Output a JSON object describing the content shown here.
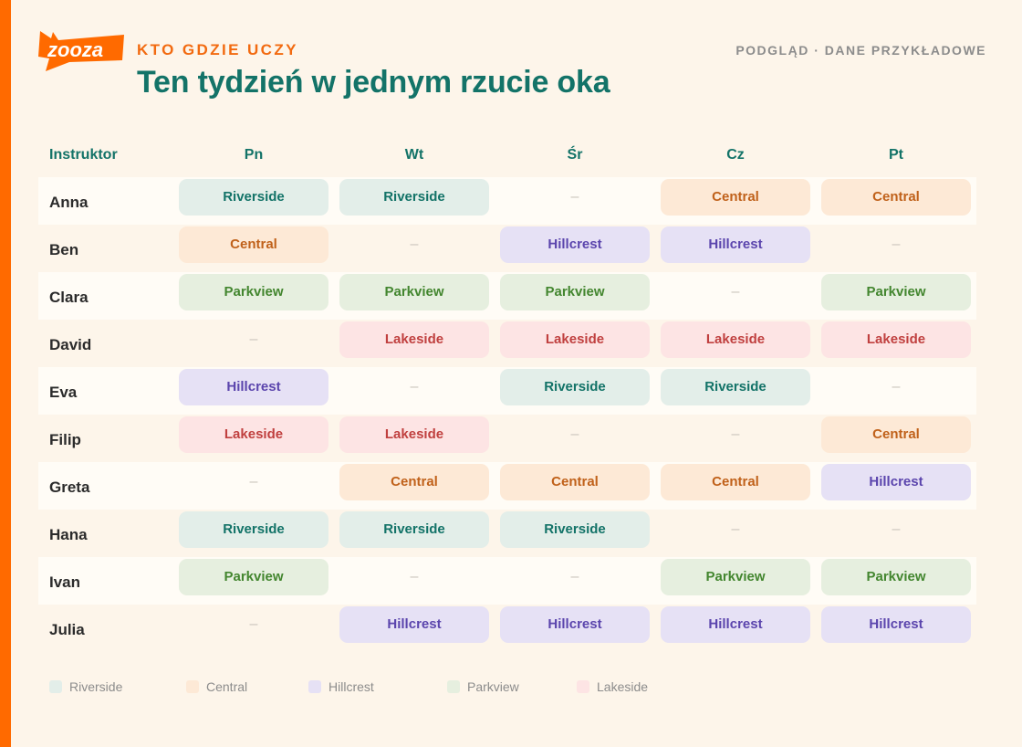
{
  "brand": {
    "logo_text": "zooza",
    "accent": "#ff6a00"
  },
  "header": {
    "kicker": "KTO GDZIE UCZY",
    "title": "Ten tydzień w jednym rzucie oka",
    "preview": "PODGLĄD · DANE PRZYKŁADOWE"
  },
  "table": {
    "name_header": "Instruktor",
    "days": [
      "Pn",
      "Wt",
      "Śr",
      "Cz",
      "Pt"
    ],
    "empty_symbol": "–",
    "rows": [
      {
        "name": "Anna",
        "cells": [
          "Riverside",
          "Riverside",
          "",
          "Central",
          "Central"
        ]
      },
      {
        "name": "Ben",
        "cells": [
          "Central",
          "",
          "Hillcrest",
          "Hillcrest",
          ""
        ]
      },
      {
        "name": "Clara",
        "cells": [
          "Parkview",
          "Parkview",
          "Parkview",
          "",
          "Parkview"
        ]
      },
      {
        "name": "David",
        "cells": [
          "",
          "Lakeside",
          "Lakeside",
          "Lakeside",
          "Lakeside"
        ]
      },
      {
        "name": "Eva",
        "cells": [
          "Hillcrest",
          "",
          "Riverside",
          "Riverside",
          ""
        ]
      },
      {
        "name": "Filip",
        "cells": [
          "Lakeside",
          "Lakeside",
          "",
          "",
          "Central"
        ]
      },
      {
        "name": "Greta",
        "cells": [
          "",
          "Central",
          "Central",
          "Central",
          "Hillcrest"
        ]
      },
      {
        "name": "Hana",
        "cells": [
          "Riverside",
          "Riverside",
          "Riverside",
          "",
          ""
        ]
      },
      {
        "name": "Ivan",
        "cells": [
          "Parkview",
          "",
          "",
          "Parkview",
          "Parkview"
        ]
      },
      {
        "name": "Julia",
        "cells": [
          "",
          "Hillcrest",
          "Hillcrest",
          "Hillcrest",
          "Hillcrest"
        ]
      }
    ]
  },
  "legend": [
    {
      "label": "Riverside",
      "color": "#e3eee9"
    },
    {
      "label": "Central",
      "color": "#fde9d6"
    },
    {
      "label": "Hillcrest",
      "color": "#e6e1f5"
    },
    {
      "label": "Parkview",
      "color": "#e6efdf"
    },
    {
      "label": "Lakeside",
      "color": "#fde4e4"
    }
  ]
}
